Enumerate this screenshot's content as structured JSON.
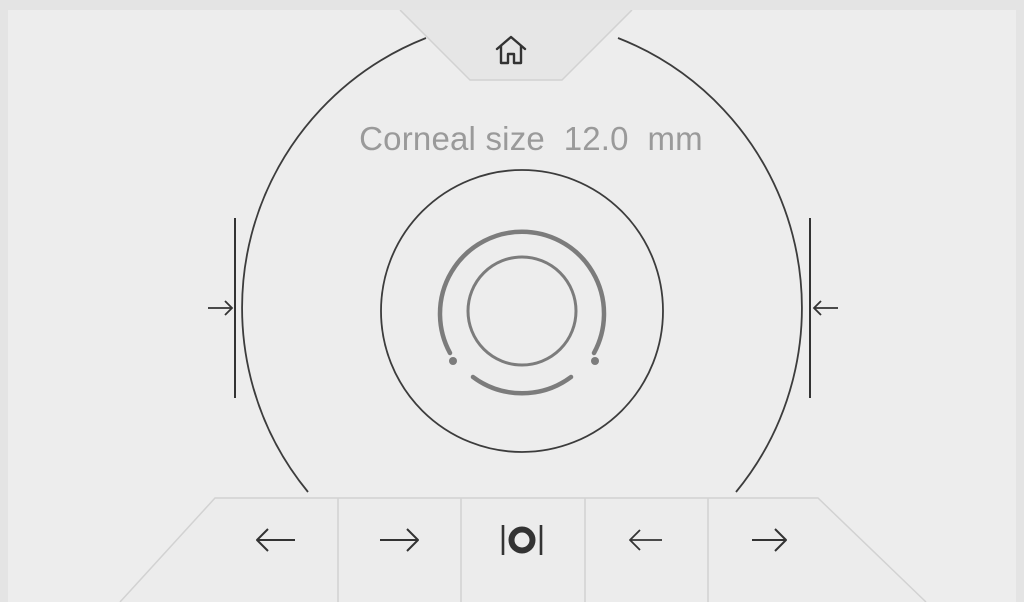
{
  "header": {
    "home_icon": "home-icon"
  },
  "readout": {
    "label": "Corneal size",
    "value": "12.0",
    "unit": "mm"
  },
  "colors": {
    "background": "#ededed",
    "line": "#3c3c3c",
    "text": "#9a9a9a",
    "indicator": "#7c7c7c"
  },
  "toolbar": {
    "buttons": [
      {
        "icon": "arrow-left-icon"
      },
      {
        "icon": "arrow-right-icon"
      },
      {
        "icon": "center-ring-icon"
      },
      {
        "icon": "arrow-left-icon"
      },
      {
        "icon": "arrow-right-icon"
      }
    ]
  }
}
